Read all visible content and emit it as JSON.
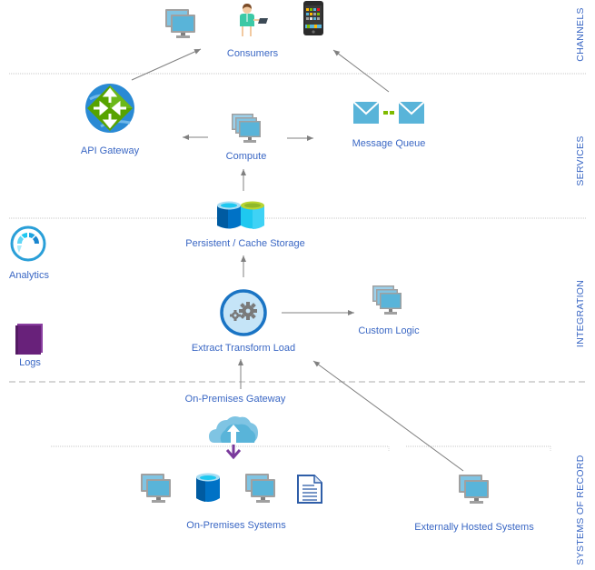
{
  "layers": [
    {
      "id": "channels",
      "label": "CHANNELS"
    },
    {
      "id": "services",
      "label": "SERVICES"
    },
    {
      "id": "integration",
      "label": "INTEGRATION"
    },
    {
      "id": "systems_of_record",
      "label": "SYSTEMS OF RECORD"
    }
  ],
  "nodes": {
    "consumers": {
      "label": "Consumers",
      "icons": [
        "desktop-monitor-icon",
        "person-with-tablet-icon",
        "smartphone-icon"
      ]
    },
    "api_gateway": {
      "label": "API Gateway",
      "icon": "api-gateway-icon"
    },
    "compute": {
      "label": "Compute",
      "icon": "server-stack-icon"
    },
    "message_queue": {
      "label": "Message Queue",
      "icon": "message-queue-icon"
    },
    "storage": {
      "label": "Persistent / Cache Storage",
      "icon": "database-pair-icon"
    },
    "analytics": {
      "label": "Analytics",
      "icon": "gauge-icon"
    },
    "logs": {
      "label": "Logs",
      "icon": "book-icon"
    },
    "etl": {
      "label": "Extract Transform Load",
      "icon": "gears-icon"
    },
    "custom_logic": {
      "label": "Custom Logic",
      "icon": "server-stack-icon"
    },
    "onprem_gateway": {
      "label": "On-Premises Gateway",
      "icon": "cloud-upload-download-icon"
    },
    "onprem_systems": {
      "label": "On-Premises Systems",
      "icons": [
        "desktop-monitor-icon",
        "database-icon",
        "desktop-monitor-icon",
        "document-icon"
      ]
    },
    "external_systems": {
      "label": "Externally Hosted Systems",
      "icon": "desktop-monitor-icon"
    }
  },
  "connections": [
    {
      "from": "api_gateway",
      "to": "consumers"
    },
    {
      "from": "message_queue",
      "to": "consumers"
    },
    {
      "from": "compute",
      "to": "api_gateway"
    },
    {
      "from": "compute",
      "to": "message_queue"
    },
    {
      "from": "storage",
      "to": "compute"
    },
    {
      "from": "etl",
      "to": "storage"
    },
    {
      "from": "etl",
      "to": "custom_logic"
    },
    {
      "from": "onprem_gateway",
      "to": "etl"
    },
    {
      "from": "external_systems",
      "to": "etl"
    }
  ],
  "colors": {
    "label_blue": "#3a67c4",
    "arrow_gray": "#808080",
    "divider_gray": "#c8c8c8",
    "monitor_blue": "#59b4d9",
    "azure_blue": "#0072c6",
    "cyan": "#1ec8f0",
    "green": "#57a300",
    "purple": "#68217a"
  }
}
